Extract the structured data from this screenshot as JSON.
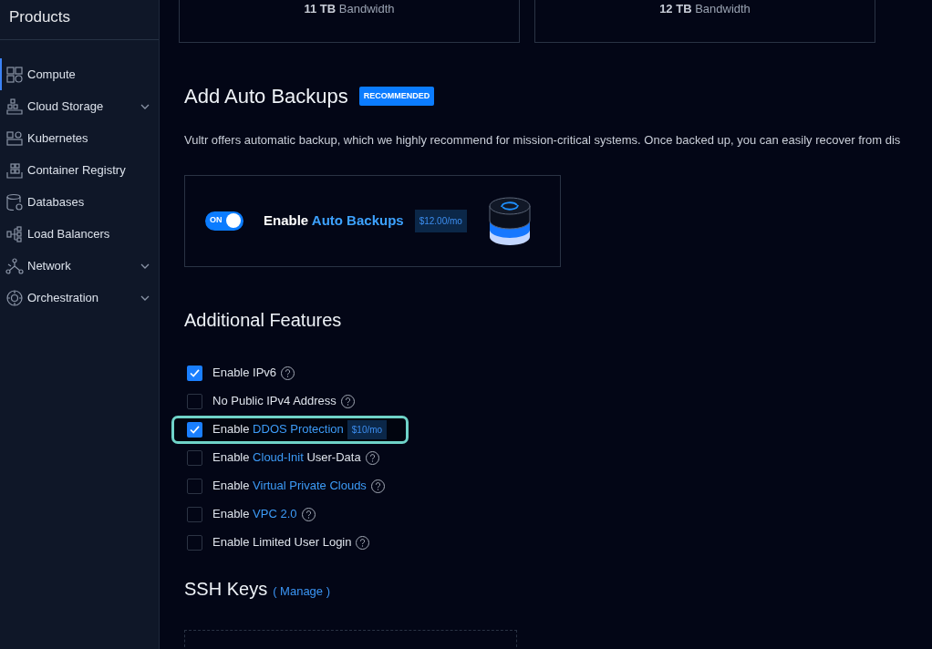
{
  "sidebar": {
    "title": "Products",
    "items": [
      {
        "label": "Compute",
        "selected": true,
        "expandable": false
      },
      {
        "label": "Cloud Storage",
        "selected": false,
        "expandable": true
      },
      {
        "label": "Kubernetes",
        "selected": false,
        "expandable": false
      },
      {
        "label": "Container Registry",
        "selected": false,
        "expandable": false
      },
      {
        "label": "Databases",
        "selected": false,
        "expandable": false
      },
      {
        "label": "Load Balancers",
        "selected": false,
        "expandable": false
      },
      {
        "label": "Network",
        "selected": false,
        "expandable": true
      },
      {
        "label": "Orchestration",
        "selected": false,
        "expandable": true
      }
    ]
  },
  "plans": [
    {
      "bandwidth": "**11 TB** Bandwidth"
    },
    {
      "bandwidth": "**12 TB** Bandwidth"
    }
  ],
  "backups": {
    "title": "Add Auto Backups",
    "badge": "RECOMMENDED",
    "description": "Vultr offers automatic backup, which we highly recommend for mission-critical systems. Once backed up, you can easily recover from dis",
    "toggle": {
      "label": "ON",
      "on": true
    },
    "label": "Enable",
    "label_link": "Auto Backups",
    "price": "$12.00/mo"
  },
  "features": {
    "title": "Additional Features",
    "items": [
      {
        "checked": true,
        "highlighted": false,
        "help": true,
        "segments": [
          {
            "kind": "plain",
            "text": "Enable IPv6"
          }
        ]
      },
      {
        "checked": false,
        "highlighted": false,
        "help": true,
        "segments": [
          {
            "kind": "plain",
            "text": "No Public IPv4 Address"
          }
        ]
      },
      {
        "checked": true,
        "highlighted": true,
        "help": false,
        "price": "$10/mo",
        "segments": [
          {
            "kind": "plain",
            "text": "Enable"
          },
          {
            "kind": "link",
            "text": "DDOS Protection"
          }
        ]
      },
      {
        "checked": false,
        "highlighted": false,
        "help": true,
        "segments": [
          {
            "kind": "plain",
            "text": "Enable"
          },
          {
            "kind": "link",
            "text": "Cloud-Init"
          },
          {
            "kind": "plain",
            "text": "User-Data"
          }
        ]
      },
      {
        "checked": false,
        "highlighted": false,
        "help": true,
        "segments": [
          {
            "kind": "plain",
            "text": "Enable"
          },
          {
            "kind": "link",
            "text": "Virtual Private Clouds"
          }
        ]
      },
      {
        "checked": false,
        "highlighted": false,
        "help": true,
        "segments": [
          {
            "kind": "plain",
            "text": "Enable"
          },
          {
            "kind": "link",
            "text": "VPC 2.0"
          }
        ]
      },
      {
        "checked": false,
        "highlighted": false,
        "help": true,
        "segments": [
          {
            "kind": "plain",
            "text": "Enable Limited User Login"
          }
        ]
      }
    ]
  },
  "ssh_keys": {
    "title": "SSH Keys",
    "link": "( Manage )"
  }
}
